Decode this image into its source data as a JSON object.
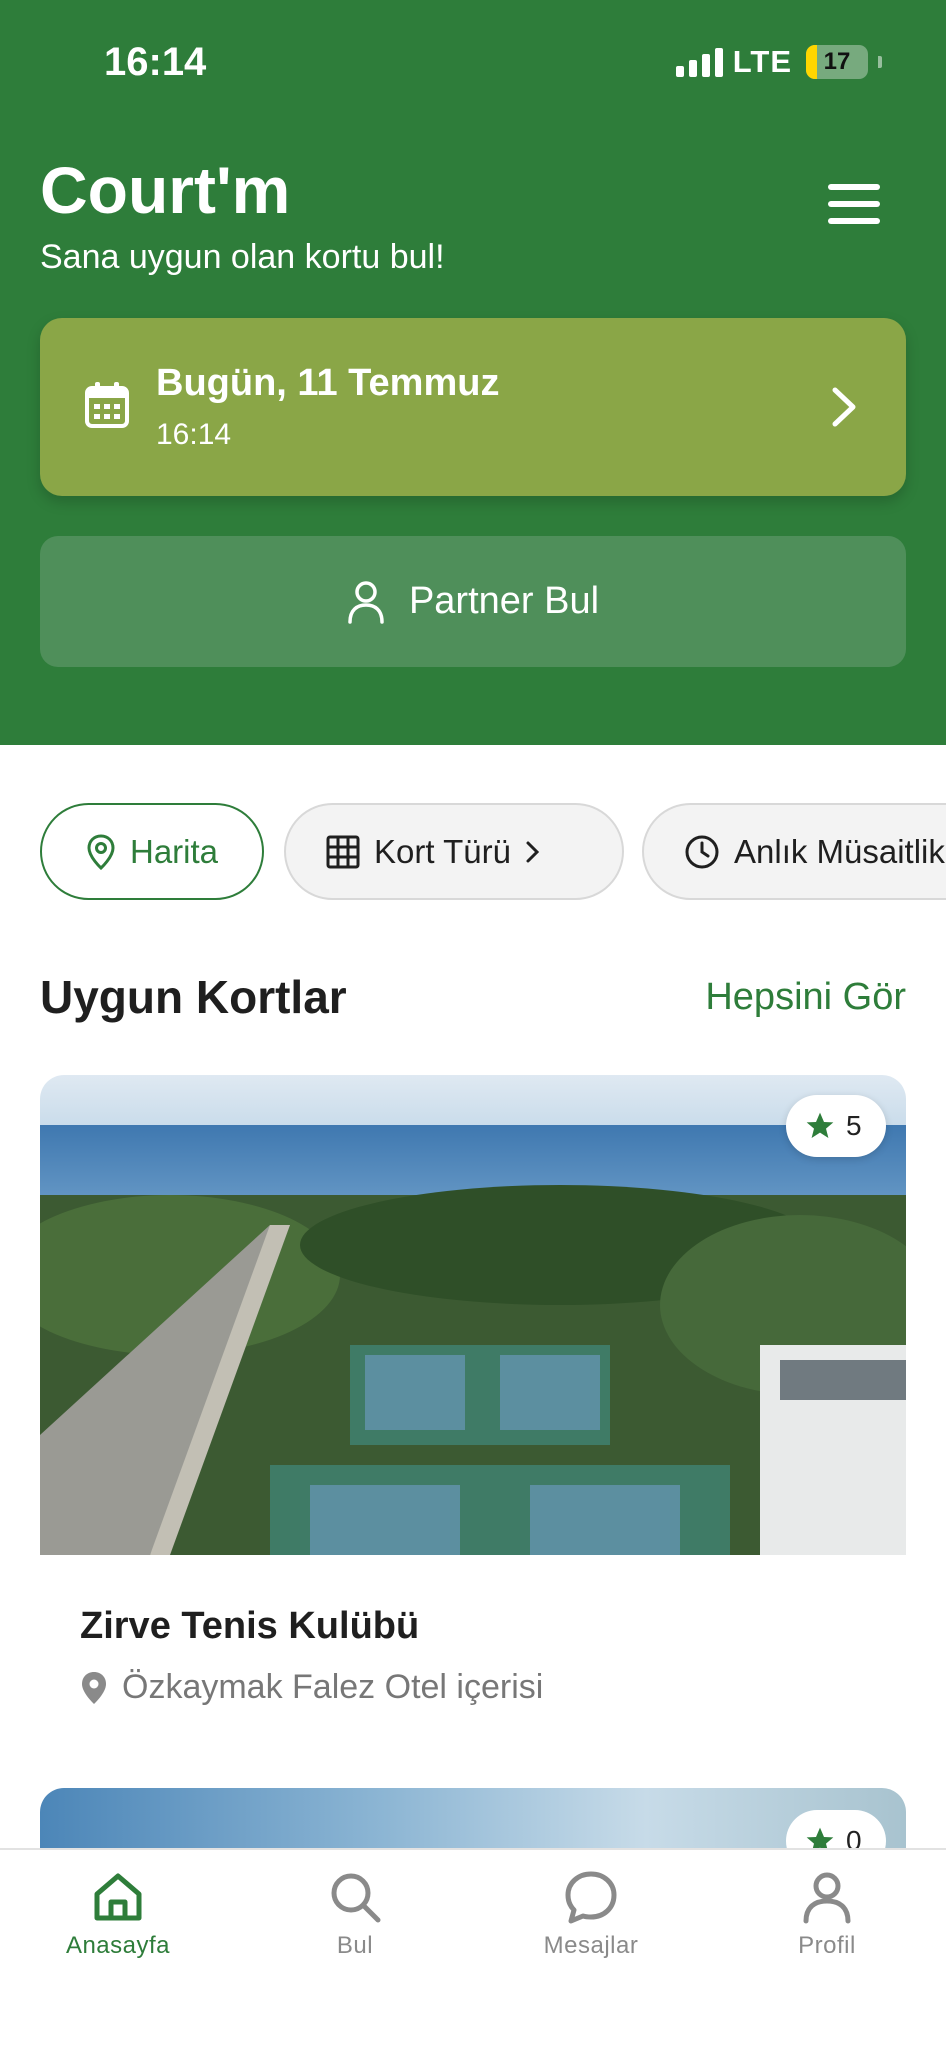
{
  "status_bar": {
    "time": "16:14",
    "network": "LTE",
    "battery": "17"
  },
  "header": {
    "title": "Court'm",
    "subtitle": "Sana uygun olan kortu bul!"
  },
  "date_card": {
    "title": "Bugün, 11 Temmuz",
    "time": "16:14"
  },
  "partner_button": {
    "label": "Partner Bul"
  },
  "filters": [
    {
      "label": "Harita",
      "icon": "location-pin-icon"
    },
    {
      "label": "Kort Türü",
      "icon": "grid-icon"
    },
    {
      "label": "Anlık Müsaitlik",
      "icon": "clock-icon"
    }
  ],
  "section": {
    "title": "Uygun Kortlar",
    "see_all": "Hepsini Gör"
  },
  "courts": [
    {
      "name": "Zirve Tenis Kulübü",
      "location": "Özkaymak Falez Otel içerisi",
      "rating": "5"
    },
    {
      "name": "",
      "location": "",
      "rating": "0"
    }
  ],
  "tabs": [
    {
      "label": "Anasayfa",
      "icon": "home-icon",
      "active": true
    },
    {
      "label": "Bul",
      "icon": "search-icon",
      "active": false
    },
    {
      "label": "Mesajlar",
      "icon": "chat-icon",
      "active": false
    },
    {
      "label": "Profil",
      "icon": "profile-icon",
      "active": false
    }
  ],
  "colors": {
    "primary": "#2e7d3a",
    "date_card": "#8aa647",
    "partner": "#4f8f5a",
    "star": "#2e7d3a"
  }
}
